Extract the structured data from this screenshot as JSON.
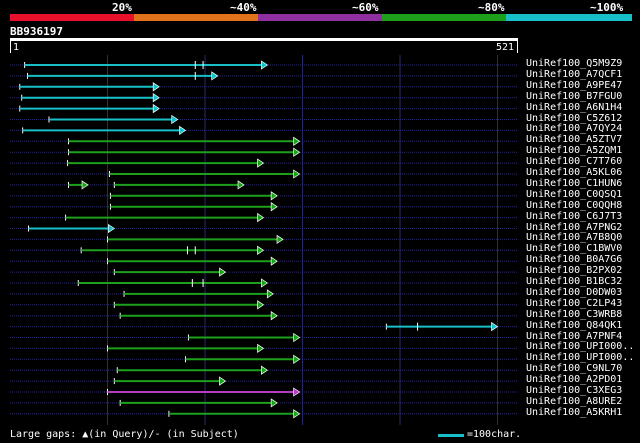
{
  "header": {
    "pct_labels": [
      "20%",
      "~40%",
      "~60%",
      "~80%",
      "~100%"
    ],
    "bar_colors": [
      "#e8102a",
      "#e0731b",
      "#8f2fa0",
      "#1da11d",
      "#17bfc8"
    ]
  },
  "query": {
    "id": "BB936197",
    "start": "1",
    "end": "521",
    "length": 521
  },
  "colors": {
    "cyan": "#17bfc8",
    "green": "#1da11d",
    "magenta": "#b53cc0",
    "grid": "#2a2a6a"
  },
  "hits": [
    {
      "name": "UniRef100_Q5M9Z9",
      "color": "cyan",
      "segments": [
        [
          15,
          264
        ]
      ],
      "gaps": [
        190,
        198
      ]
    },
    {
      "name": "UniRef100_A7QCF1",
      "color": "cyan",
      "segments": [
        [
          18,
          213
        ]
      ],
      "gaps": [
        190
      ]
    },
    {
      "name": "UniRef100_A9PE47",
      "color": "cyan",
      "segments": [
        [
          10,
          153
        ]
      ],
      "gaps": []
    },
    {
      "name": "UniRef100_B7FGU0",
      "color": "cyan",
      "segments": [
        [
          12,
          153
        ]
      ],
      "gaps": []
    },
    {
      "name": "UniRef100_A6N1H4",
      "color": "cyan",
      "segments": [
        [
          10,
          153
        ]
      ],
      "gaps": []
    },
    {
      "name": "UniRef100_C5Z612",
      "color": "cyan",
      "segments": [
        [
          40,
          172
        ]
      ],
      "gaps": []
    },
    {
      "name": "UniRef100_A7QY24",
      "color": "cyan",
      "segments": [
        [
          13,
          180
        ]
      ],
      "gaps": []
    },
    {
      "name": "UniRef100_A5ZTV7",
      "color": "green",
      "segments": [
        [
          60,
          297
        ]
      ],
      "gaps": []
    },
    {
      "name": "UniRef100_A5ZQM1",
      "color": "green",
      "segments": [
        [
          60,
          297
        ]
      ],
      "gaps": []
    },
    {
      "name": "UniRef100_C7T760",
      "color": "green",
      "segments": [
        [
          59,
          260
        ]
      ],
      "gaps": []
    },
    {
      "name": "UniRef100_A5KL06",
      "color": "green",
      "segments": [
        [
          102,
          297
        ]
      ],
      "gaps": []
    },
    {
      "name": "UniRef100_C1HUN6",
      "color": "green",
      "segments": [
        [
          60,
          80
        ],
        [
          107,
          240
        ]
      ],
      "gaps": []
    },
    {
      "name": "UniRef100_C0QSQ1",
      "color": "green",
      "segments": [
        [
          103,
          274
        ]
      ],
      "gaps": []
    },
    {
      "name": "UniRef100_C0QQH8",
      "color": "green",
      "segments": [
        [
          103,
          274
        ]
      ],
      "gaps": []
    },
    {
      "name": "UniRef100_C6J7T3",
      "color": "green",
      "segments": [
        [
          57,
          260
        ]
      ],
      "gaps": []
    },
    {
      "name": "UniRef100_A7PNG2",
      "color": "cyan",
      "segments": [
        [
          19,
          107
        ]
      ],
      "gaps": []
    },
    {
      "name": "UniRef100_A7B8Q0",
      "color": "green",
      "segments": [
        [
          100,
          280
        ]
      ],
      "gaps": []
    },
    {
      "name": "UniRef100_C1BWV0",
      "color": "green",
      "segments": [
        [
          73,
          260
        ]
      ],
      "gaps": [
        182,
        190
      ]
    },
    {
      "name": "UniRef100_B0A7G6",
      "color": "green",
      "segments": [
        [
          100,
          274
        ]
      ],
      "gaps": []
    },
    {
      "name": "UniRef100_B2PX02",
      "color": "green",
      "segments": [
        [
          107,
          221
        ]
      ],
      "gaps": []
    },
    {
      "name": "UniRef100_B1BC32",
      "color": "green",
      "segments": [
        [
          70,
          264
        ]
      ],
      "gaps": [
        187,
        198
      ]
    },
    {
      "name": "UniRef100_D0DW03",
      "color": "green",
      "segments": [
        [
          117,
          270
        ]
      ],
      "gaps": []
    },
    {
      "name": "UniRef100_C2LP43",
      "color": "green",
      "segments": [
        [
          107,
          260
        ]
      ],
      "gaps": []
    },
    {
      "name": "UniRef100_C3WRB8",
      "color": "green",
      "segments": [
        [
          113,
          274
        ]
      ],
      "gaps": []
    },
    {
      "name": "UniRef100_Q84QK1",
      "color": "cyan",
      "segments": [
        [
          386,
          500
        ]
      ],
      "gaps": [
        418
      ]
    },
    {
      "name": "UniRef100_A7PNF4",
      "color": "green",
      "segments": [
        [
          183,
          297
        ]
      ],
      "gaps": []
    },
    {
      "name": "UniRef100_UPI000..",
      "color": "green",
      "segments": [
        [
          100,
          260
        ]
      ],
      "gaps": []
    },
    {
      "name": "UniRef100_UPI000..",
      "color": "green",
      "segments": [
        [
          180,
          297
        ]
      ],
      "gaps": []
    },
    {
      "name": "UniRef100_C9NL70",
      "color": "green",
      "segments": [
        [
          110,
          264
        ]
      ],
      "gaps": []
    },
    {
      "name": "UniRef100_A2PD01",
      "color": "green",
      "segments": [
        [
          107,
          221
        ]
      ],
      "gaps": []
    },
    {
      "name": "UniRef100_C3XEG3",
      "color": "magenta",
      "segments": [
        [
          100,
          297
        ]
      ],
      "gaps": []
    },
    {
      "name": "UniRef100_A8URE2",
      "color": "green",
      "segments": [
        [
          113,
          274
        ]
      ],
      "gaps": []
    },
    {
      "name": "UniRef100_A5KRH1",
      "color": "green",
      "segments": [
        [
          163,
          297
        ]
      ],
      "gaps": []
    }
  ],
  "footer": {
    "left": "Large gaps: ▲(in Query)/- (in Subject)",
    "right": "=100char."
  }
}
